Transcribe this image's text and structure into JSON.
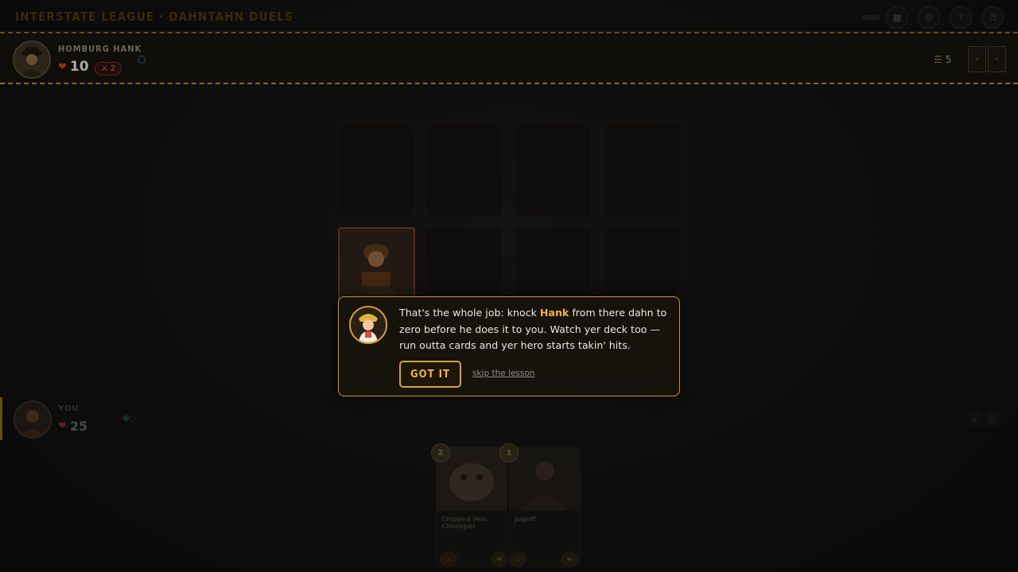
{
  "title": "INTERSTATE LEAGUE · DAHNTAHN DUELS",
  "top_icons": [
    "trash-icon",
    "gear-icon",
    "help-icon",
    "sound-icon"
  ],
  "opponent": {
    "name": "HOMBURG HANK",
    "hp": "10",
    "attack": "2",
    "deck_count": "5"
  },
  "player": {
    "name": "YOU",
    "hp": "25"
  },
  "hand": [
    {
      "name": "Chipped Hoo Cheeeper",
      "cost": "2"
    },
    {
      "name": "Jugoff",
      "cost": "1"
    }
  ],
  "tutorial": {
    "text_before": "That's the whole job: knock ",
    "highlight": "Hank",
    "text_after": " from there dahn to zero before he does it to you. Watch yer deck too — run outta cards and yer hero starts takin' hits.",
    "primary_button": "GOT IT",
    "skip_link": "skip the lesson"
  },
  "colors": {
    "accent": "#d6a334",
    "panel_dash": "#c4921e",
    "heart": "#d13a30"
  }
}
